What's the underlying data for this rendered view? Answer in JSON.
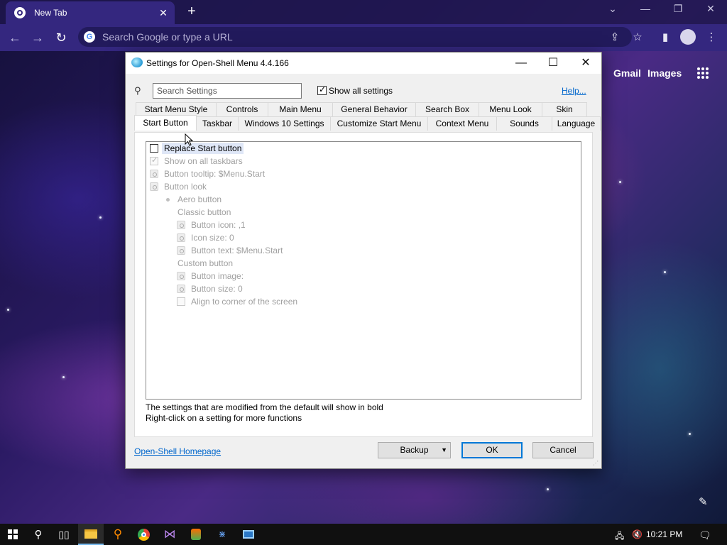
{
  "browser": {
    "tab_title": "New Tab",
    "omnibox_placeholder": "Search Google or type a URL",
    "links": {
      "gmail": "Gmail",
      "images": "Images"
    }
  },
  "dialog": {
    "title": "Settings for Open-Shell Menu 4.4.166",
    "search_placeholder": "Search Settings",
    "show_all_label": "Show all settings",
    "show_all_checked": true,
    "help_link": "Help...",
    "tabs_row1": [
      "Start Menu Style",
      "Controls",
      "Main Menu",
      "General Behavior",
      "Search Box",
      "Menu Look",
      "Skin"
    ],
    "tabs_row2": [
      "Start Button",
      "Taskbar",
      "Windows 10 Settings",
      "Customize Start Menu",
      "Context Menu",
      "Sounds",
      "Language"
    ],
    "active_tab": "Start Button",
    "settings": [
      {
        "label": "Replace Start button",
        "kind": "checkbox",
        "checked": false,
        "enabled": true,
        "selected": true
      },
      {
        "label": "Show on all taskbars",
        "kind": "checkbox",
        "checked": true,
        "enabled": false
      },
      {
        "label": "Button tooltip: $Menu.Start",
        "kind": "setting",
        "enabled": false
      },
      {
        "label": "Button look",
        "kind": "setting",
        "enabled": false
      },
      {
        "label": "Aero button",
        "kind": "radio",
        "enabled": false
      },
      {
        "label": "Classic button",
        "kind": "group",
        "enabled": false
      },
      {
        "label": "Button icon: ,1",
        "kind": "setting",
        "enabled": false
      },
      {
        "label": "Icon size: 0",
        "kind": "setting",
        "enabled": false
      },
      {
        "label": "Button text: $Menu.Start",
        "kind": "setting",
        "enabled": false
      },
      {
        "label": "Custom button",
        "kind": "group",
        "enabled": false
      },
      {
        "label": "Button image:",
        "kind": "setting",
        "enabled": false
      },
      {
        "label": "Button size: 0",
        "kind": "setting",
        "enabled": false
      },
      {
        "label": "Align to corner of the screen",
        "kind": "checkbox",
        "checked": false,
        "enabled": false
      }
    ],
    "hint_line1": "The settings that are modified from the default will show in bold",
    "hint_line2": "Right-click on a setting for more functions",
    "homepage_link": "Open-Shell Homepage",
    "buttons": {
      "backup": "Backup",
      "ok": "OK",
      "cancel": "Cancel"
    }
  },
  "taskbar": {
    "clock": "10:21 PM"
  }
}
